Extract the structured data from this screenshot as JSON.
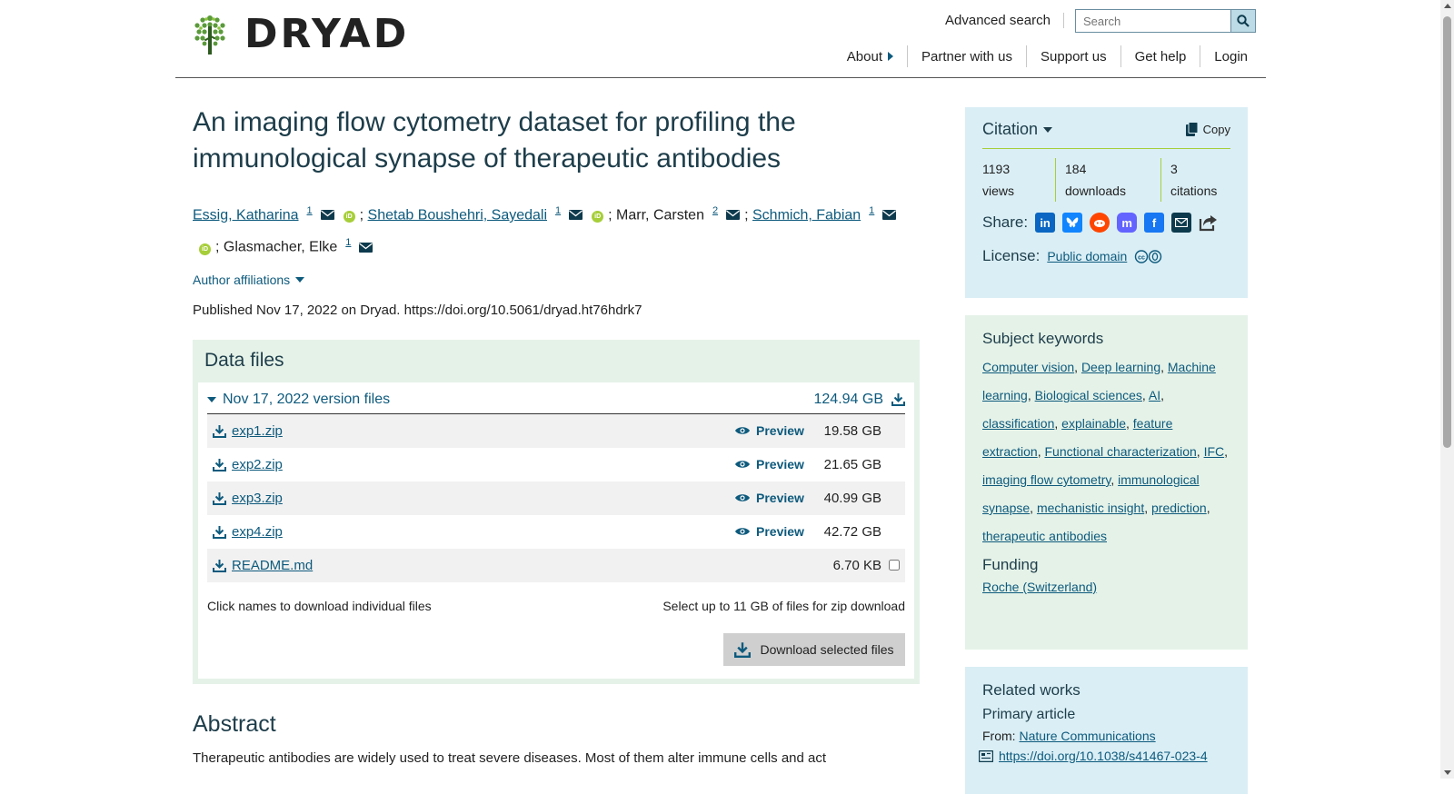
{
  "header": {
    "logo_text": "DRYAD",
    "advanced_search": "Advanced search",
    "search_placeholder": "Search",
    "nav": [
      "About",
      "Partner with us",
      "Support us",
      "Get help",
      "Login"
    ]
  },
  "dataset": {
    "title": "An imaging flow cytometry dataset for profiling the immunological synapse of therapeutic antibodies",
    "authors": [
      {
        "name": "Essig, Katharina",
        "affil": "1"
      },
      {
        "name": "Shetab Boushehri, Sayedali",
        "affil": "1"
      },
      {
        "name": "Marr, Carsten",
        "affil": "2"
      },
      {
        "name": "Schmich, Fabian",
        "affil": "1"
      },
      {
        "name": "Glasmacher, Elke",
        "affil": "1"
      }
    ],
    "orcid_label": "iD",
    "affiliations_label": "Author affiliations",
    "published": "Published Nov 17, 2022 on Dryad. https://doi.org/10.5061/dryad.ht76hdrk7"
  },
  "data_files": {
    "title": "Data files",
    "version_label": "Nov 17, 2022 version files",
    "version_size": "124.94 GB",
    "preview_label": "Preview",
    "files": [
      {
        "name": "exp1.zip",
        "size": "19.58 GB"
      },
      {
        "name": "exp2.zip",
        "size": "21.65 GB"
      },
      {
        "name": "exp3.zip",
        "size": "40.99 GB"
      },
      {
        "name": "exp4.zip",
        "size": "42.72 GB"
      },
      {
        "name": "README.md",
        "size": "6.70 KB"
      }
    ],
    "hint_left": "Click names to download individual files",
    "hint_right": "Select up to 11 GB of files for zip download",
    "download_button": "Download selected files"
  },
  "abstract": {
    "title": "Abstract",
    "text": "Therapeutic antibodies are widely used to treat severe diseases. Most of them alter immune cells and act"
  },
  "citation": {
    "title": "Citation",
    "copy": "Copy",
    "stats": [
      {
        "value": "1193",
        "label": "views"
      },
      {
        "value": "184",
        "label": "downloads"
      },
      {
        "value": "3",
        "label": "citations"
      }
    ],
    "share_label": "Share:",
    "license_label": "License:",
    "license_value": "Public domain"
  },
  "keywords": {
    "title": "Subject keywords",
    "items": [
      "Computer vision",
      "Deep learning",
      "Machine learning",
      "Biological sciences",
      "AI",
      "classification",
      "explainable",
      "feature extraction",
      "Functional characterization",
      "IFC",
      "imaging flow cytometry",
      "immunological synapse",
      "mechanistic insight",
      "prediction",
      "therapeutic antibodies"
    ],
    "funding_title": "Funding",
    "funding": "Roche (Switzerland)"
  },
  "related": {
    "title": "Related works",
    "primary": "Primary article",
    "from_label": "From:",
    "from_value": "Nature Communications",
    "doi": "https://doi.org/10.1038/s41467-023-4"
  },
  "colors": {
    "link": "#0d5a7d",
    "citation_bg": "#daeef5",
    "keywords_bg": "#e5f2e8",
    "orcid": "#a6ce39"
  }
}
